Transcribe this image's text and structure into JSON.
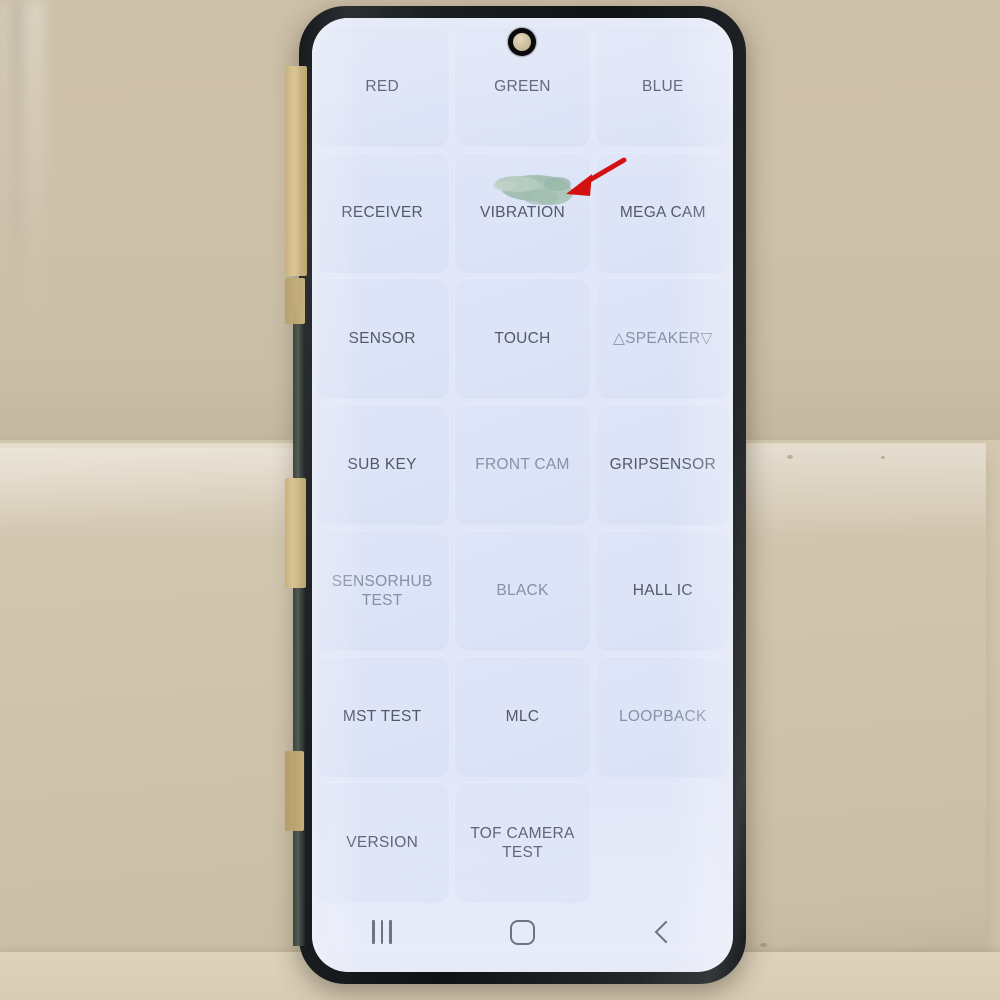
{
  "device": {
    "name": "samsung-galaxy-phone",
    "screen_app": "Factory Test Mode Grid"
  },
  "colors": {
    "tile_bg": "#dde4f7",
    "tile_text": "#53586b",
    "tile_text_dim": "#8890a4",
    "arrow": "#d41111",
    "smudge": "#8fb39a",
    "nav_icon": "#6d7384",
    "wall": "#cdc0a9",
    "box": "#cfc2ab"
  },
  "grid": {
    "columns": 3,
    "tiles": [
      {
        "label": "RED",
        "dim": false
      },
      {
        "label": "GREEN",
        "dim": false
      },
      {
        "label": "BLUE",
        "dim": false
      },
      {
        "label": "RECEIVER",
        "dim": false
      },
      {
        "label": "VIBRATION",
        "dim": false
      },
      {
        "label": "MEGA CAM",
        "dim": false
      },
      {
        "label": "SENSOR",
        "dim": false
      },
      {
        "label": "TOUCH",
        "dim": false
      },
      {
        "label": "△SPEAKER▽",
        "dim": true
      },
      {
        "label": "SUB KEY",
        "dim": false
      },
      {
        "label": "FRONT CAM",
        "dim": true
      },
      {
        "label": "GRIPSENSOR",
        "dim": false
      },
      {
        "label": "SENSORHUB TEST",
        "dim": true
      },
      {
        "label": "BLACK",
        "dim": true
      },
      {
        "label": "HALL IC",
        "dim": false
      },
      {
        "label": "MST TEST",
        "dim": false
      },
      {
        "label": "MLC",
        "dim": false
      },
      {
        "label": "LOOPBACK",
        "dim": true
      },
      {
        "label": "VERSION",
        "dim": false
      },
      {
        "label": "TOF CAMERA TEST",
        "dim": false
      },
      {
        "label": "",
        "dim": false,
        "empty": true
      }
    ]
  },
  "navbar": {
    "items": [
      {
        "name": "recents-button",
        "icon": "recents-icon"
      },
      {
        "name": "home-button",
        "icon": "home-icon"
      },
      {
        "name": "back-button",
        "icon": "back-chevron-icon"
      }
    ]
  },
  "annotation": {
    "arrow_color": "#d41111",
    "points_to": "VIBRATION"
  }
}
